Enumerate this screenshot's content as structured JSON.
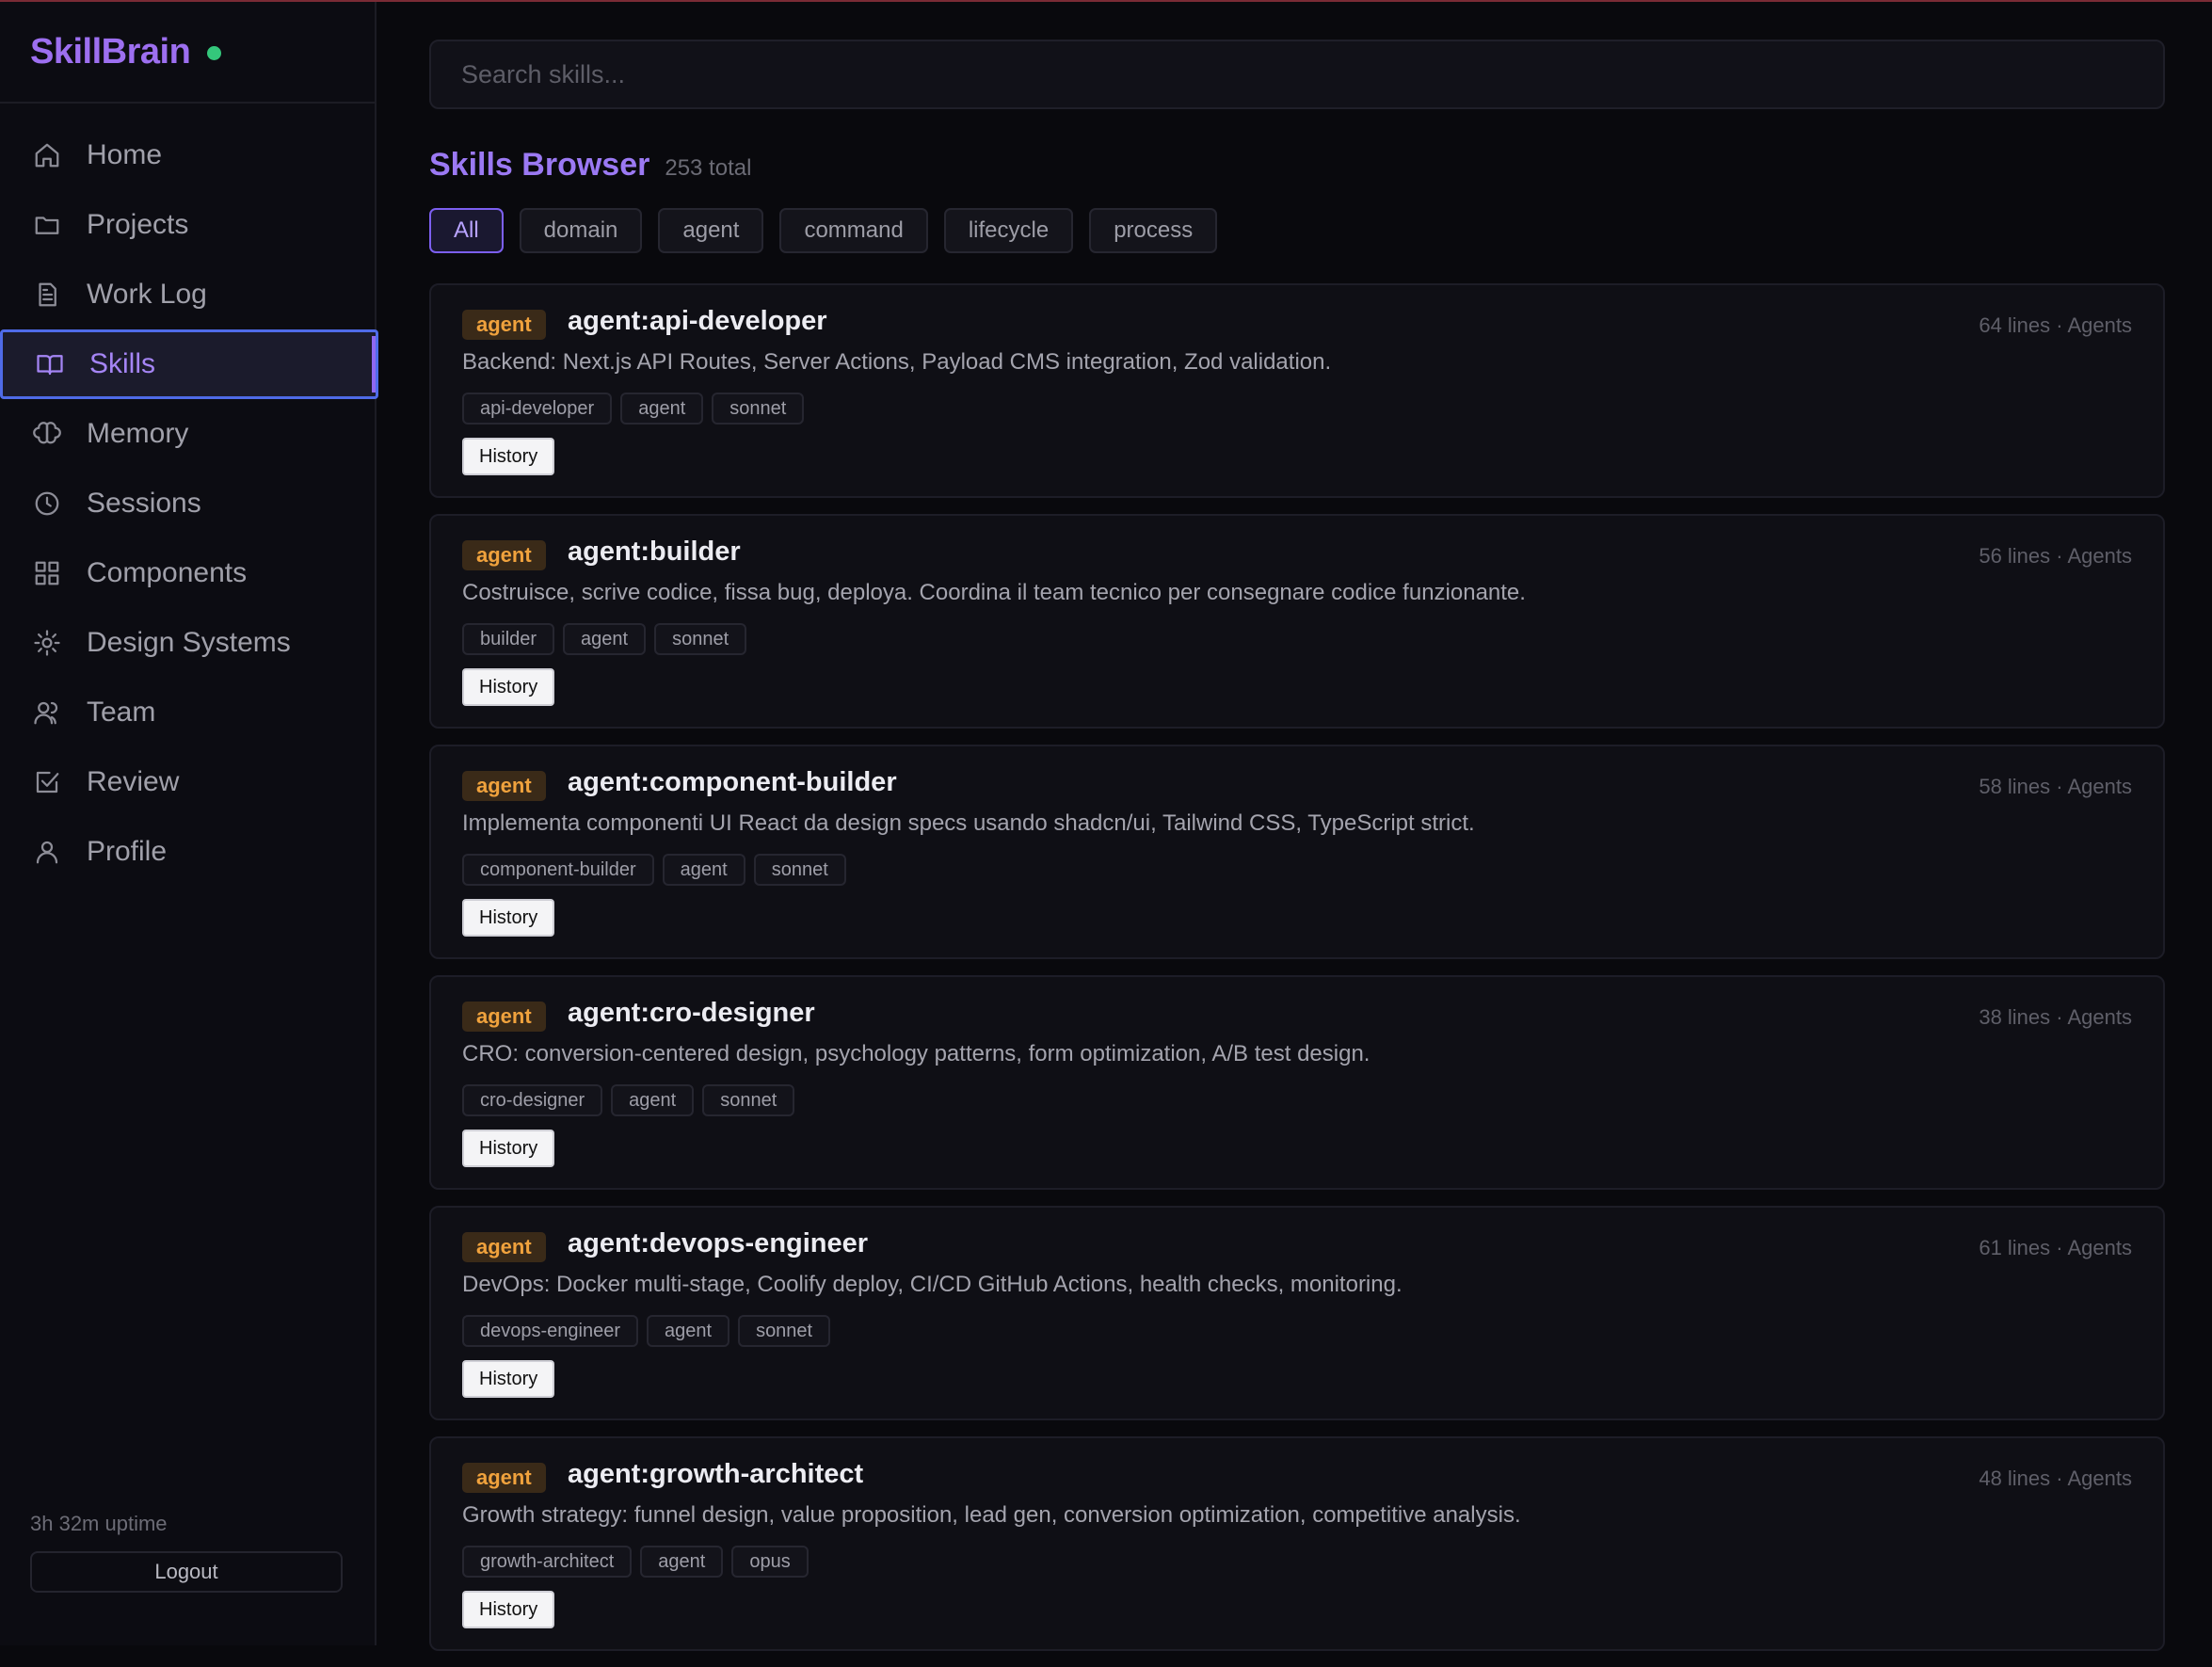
{
  "brand": {
    "name": "SkillBrain",
    "status_color": "#34c77b"
  },
  "sidebar": {
    "items": [
      {
        "label": "Home",
        "icon": "home-icon"
      },
      {
        "label": "Projects",
        "icon": "folder-icon"
      },
      {
        "label": "Work Log",
        "icon": "document-icon"
      },
      {
        "label": "Skills",
        "icon": "book-icon",
        "active": true
      },
      {
        "label": "Memory",
        "icon": "brain-icon"
      },
      {
        "label": "Sessions",
        "icon": "clock-icon"
      },
      {
        "label": "Components",
        "icon": "grid-icon"
      },
      {
        "label": "Design Systems",
        "icon": "sun-icon"
      },
      {
        "label": "Team",
        "icon": "users-icon"
      },
      {
        "label": "Review",
        "icon": "check-square-icon"
      },
      {
        "label": "Profile",
        "icon": "user-icon"
      }
    ],
    "uptime": "3h 32m uptime",
    "logout_label": "Logout"
  },
  "search": {
    "placeholder": "Search skills..."
  },
  "page": {
    "title": "Skills Browser",
    "count": "253 total"
  },
  "filters": [
    "All",
    "domain",
    "agent",
    "command",
    "lifecycle",
    "process"
  ],
  "active_filter": "All",
  "skills": [
    {
      "type": "agent",
      "name": "agent:api-developer",
      "meta": "64 lines · Agents",
      "description": "Backend: Next.js API Routes, Server Actions, Payload CMS integration, Zod validation.",
      "tags": [
        "api-developer",
        "agent",
        "sonnet"
      ],
      "history_label": "History"
    },
    {
      "type": "agent",
      "name": "agent:builder",
      "meta": "56 lines · Agents",
      "description": "Costruisce, scrive codice, fissa bug, deploya. Coordina il team tecnico per consegnare codice funzionante.",
      "tags": [
        "builder",
        "agent",
        "sonnet"
      ],
      "history_label": "History"
    },
    {
      "type": "agent",
      "name": "agent:component-builder",
      "meta": "58 lines · Agents",
      "description": "Implementa componenti UI React da design specs usando shadcn/ui, Tailwind CSS, TypeScript strict.",
      "tags": [
        "component-builder",
        "agent",
        "sonnet"
      ],
      "history_label": "History"
    },
    {
      "type": "agent",
      "name": "agent:cro-designer",
      "meta": "38 lines · Agents",
      "description": "CRO: conversion-centered design, psychology patterns, form optimization, A/B test design.",
      "tags": [
        "cro-designer",
        "agent",
        "sonnet"
      ],
      "history_label": "History"
    },
    {
      "type": "agent",
      "name": "agent:devops-engineer",
      "meta": "61 lines · Agents",
      "description": "DevOps: Docker multi-stage, Coolify deploy, CI/CD GitHub Actions, health checks, monitoring.",
      "tags": [
        "devops-engineer",
        "agent",
        "sonnet"
      ],
      "history_label": "History"
    },
    {
      "type": "agent",
      "name": "agent:growth-architect",
      "meta": "48 lines · Agents",
      "description": "Growth strategy: funnel design, value proposition, lead gen, conversion optimization, competitive analysis.",
      "tags": [
        "growth-architect",
        "agent",
        "opus"
      ],
      "history_label": "History"
    }
  ],
  "colors": {
    "accent": "#9b79f3",
    "badge_agent": "#f0a23d",
    "active_border": "#4f6be8"
  }
}
